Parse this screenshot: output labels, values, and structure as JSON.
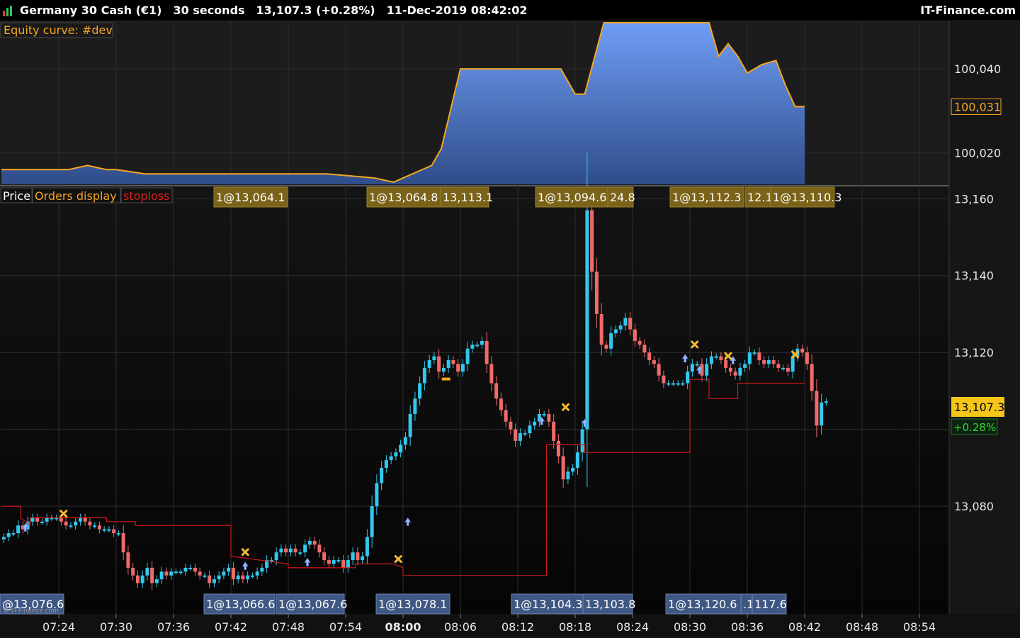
{
  "header": {
    "instrument": "Germany 30 Cash (€1)",
    "timeframe": "30 seconds",
    "quote": "13,107.3 (+0.28%)",
    "datetime": "11-Dec-2019 08:42:02",
    "brand": "IT-Finance.com",
    "watermark": "© IT-Finance.com"
  },
  "equity_panel": {
    "label": "Equity curve: #dev"
  },
  "price_panel": {
    "price_tab": "Price",
    "orders_tab": "Orders display",
    "stoploss_tab": "stoploss",
    "last_price_tag": "13,107.3",
    "change_tag": "+0.28%"
  },
  "order_labels_top": [
    "1@13,064.1",
    "1@13,064.8",
    "13,113.1",
    "1@13,094.6",
    "24.8",
    "1@13,112.3",
    "12.1",
    "1@13,110.3"
  ],
  "order_labels_bottom": [
    "@13,076.6",
    "1@13,066.6",
    "1@13,067.6",
    "1@13,078.1",
    "1@13,104.3",
    "13,103.8",
    "1@13,120.6",
    ".1",
    "117.6"
  ],
  "colors": {
    "bull": "#33c8ee",
    "bear": "#f06a6a",
    "equity_line": "#f5a623",
    "equity_fill_top": "#6f9df5",
    "equity_fill_bottom": "#2f4d8a",
    "stoploss": "#d01818",
    "order_label_gold": "#7a6218",
    "order_label_blue": "#3e5883",
    "last_price_bg": "#f5c518"
  },
  "chart_data": [
    {
      "type": "area",
      "name": "equity",
      "ylim": [
        100012.5,
        100051
      ],
      "ticks": [
        100020,
        100040
      ],
      "tick_labels": [
        "100,020",
        "100,040"
      ],
      "last_value_label": "100,031",
      "x": [
        "07:18:00",
        "07:25:00",
        "07:27:00",
        "07:29:00",
        "07:30:00",
        "07:33:00",
        "07:35:00",
        "07:52:00",
        "07:57:00",
        "07:59:00",
        "08:00:00",
        "08:03:00",
        "08:04:00",
        "08:06:00",
        "08:10:00",
        "08:15:30",
        "08:16:30",
        "08:18:00",
        "08:19:00",
        "08:21:00",
        "08:32:00",
        "08:33:00",
        "08:34:00",
        "08:35:00",
        "08:36:00",
        "08:37:30",
        "08:39:00",
        "08:40:00",
        "08:41:00",
        "08:42:00"
      ],
      "y": [
        100016,
        100016,
        100017,
        100016,
        100016,
        100015,
        100015,
        100015,
        100014,
        100013,
        100014,
        100017,
        100021,
        100040,
        100040,
        100040,
        100040,
        100034,
        100034,
        100051,
        100051,
        100043,
        100046,
        100043,
        100039,
        100041,
        100042,
        100036,
        100031,
        100031
      ]
    },
    {
      "type": "candlestick",
      "name": "price",
      "ylim": [
        13052,
        13163
      ],
      "ticks": [
        13080,
        13100,
        13120,
        13140,
        13160
      ],
      "tick_labels": [
        "13,080",
        "13,100",
        "13,120",
        "13,140",
        "13,160"
      ],
      "x_ticks": [
        "07:24",
        "07:30",
        "07:36",
        "07:42",
        "07:48",
        "07:54",
        "08:00",
        "08:06",
        "08:12",
        "08:18",
        "08:24",
        "08:30",
        "08:36",
        "08:42",
        "08:48",
        "08:54"
      ],
      "x_bold_tick": "08:00",
      "last_price": 13107.3,
      "candle_interval_seconds": 30,
      "first_candle_time": "07:18:00",
      "close": [
        13072,
        13073,
        13073,
        13075,
        13074,
        13076,
        13077,
        13076,
        13076,
        13077,
        13077,
        13077,
        13076,
        13075,
        13075,
        13076,
        13077,
        13076,
        13075,
        13075,
        13074,
        13074,
        13074,
        13073,
        13073,
        13068,
        13064,
        13062,
        13060,
        13062,
        13064,
        13060,
        13061,
        13063,
        13062,
        13063,
        13063,
        13063,
        13064,
        13064,
        13063,
        13062,
        13062,
        13060,
        13061,
        13062,
        13063,
        13064,
        13061,
        13062,
        13061,
        13062,
        13062,
        13063,
        13064,
        13066,
        13066,
        13068,
        13069,
        13068,
        13069,
        13068,
        13068,
        13070,
        13071,
        13070,
        13068,
        13066,
        13065,
        13066,
        13066,
        13064,
        13066,
        13068,
        13066,
        13067,
        13072,
        13080,
        13086,
        13090,
        13092,
        13093,
        13094,
        13096,
        13098,
        13104,
        13108,
        13112,
        13116,
        13118,
        13119,
        13115,
        13116,
        13118,
        13117,
        13115,
        13117,
        13121,
        13122,
        13122,
        13123,
        13117,
        13112,
        13108,
        13105,
        13102,
        13100,
        13097,
        13099,
        13099,
        13101,
        13102,
        13104,
        13104,
        13102,
        13097,
        13093,
        13087,
        13089,
        13090,
        13094,
        13100,
        13157,
        13141,
        13130,
        13122,
        13121,
        13125,
        13126,
        13127,
        13129,
        13126,
        13123,
        13122,
        13120,
        13118,
        13117,
        13114,
        13112,
        13112,
        13112,
        13112,
        13112,
        13115,
        13117,
        13117,
        13114,
        13117,
        13119,
        13119,
        13118,
        13116,
        13115,
        13114,
        13116,
        13117,
        13120,
        13120,
        13118,
        13117,
        13118,
        13117,
        13116,
        13116,
        13115,
        13119,
        13121,
        13120,
        13117,
        13110,
        13101,
        13107,
        13107.3
      ],
      "stoploss": {
        "x": [
          "07:18:00",
          "07:20:00",
          "07:20:00",
          "07:21:00",
          "07:21:00",
          "07:29:00",
          "07:29:00",
          "07:32:00",
          "07:32:00",
          "07:42:00",
          "07:42:00",
          "07:48:00",
          "07:48:00",
          "07:55:00",
          "07:55:00",
          "07:59:00",
          "08:00:00",
          "08:00:00",
          "08:15:00",
          "08:15:00",
          "08:19:00",
          "08:19:00",
          "08:30:00",
          "08:30:00",
          "08:32:00",
          "08:32:00",
          "08:35:00",
          "08:35:00",
          "08:42:00"
        ],
        "y": [
          13080,
          13080,
          13077,
          13075,
          13077,
          13077,
          13076,
          13076,
          13075,
          13075,
          13067,
          13065,
          13064,
          13064,
          13065,
          13065,
          13064,
          13062,
          13062,
          13096,
          13096,
          13094,
          13094,
          13113,
          13113,
          13108,
          13108,
          13112,
          13112
        ]
      },
      "buy_markers": [
        {
          "t": "07:20:30",
          "price": 13076.6
        },
        {
          "t": "07:43:30",
          "price": 13066.6
        },
        {
          "t": "07:50:00",
          "price": 13067.6
        },
        {
          "t": "08:00:30",
          "price": 13078.1
        },
        {
          "t": "08:14:30",
          "price": 13104.3
        },
        {
          "t": "08:19:00",
          "price": 13103.8
        },
        {
          "t": "08:29:30",
          "price": 13120.6
        },
        {
          "t": "08:31:00",
          "price": 13117.6
        },
        {
          "t": "08:34:30",
          "price": 13120.1
        }
      ],
      "exit_markers": [
        {
          "t": "07:24:30",
          "price": 13076.6
        },
        {
          "t": "07:43:30",
          "price": 13066.6
        },
        {
          "t": "07:59:30",
          "price": 13064.8
        },
        {
          "t": "08:17:00",
          "price": 13104.3
        },
        {
          "t": "08:30:30",
          "price": 13120.6
        },
        {
          "t": "08:34:00",
          "price": 13117.6
        },
        {
          "t": "08:41:00",
          "price": 13118
        }
      ],
      "short_markers": [
        {
          "t": "08:04:30",
          "price": 13113.1
        },
        {
          "t": "08:19:00",
          "price": 13160
        }
      ]
    }
  ]
}
